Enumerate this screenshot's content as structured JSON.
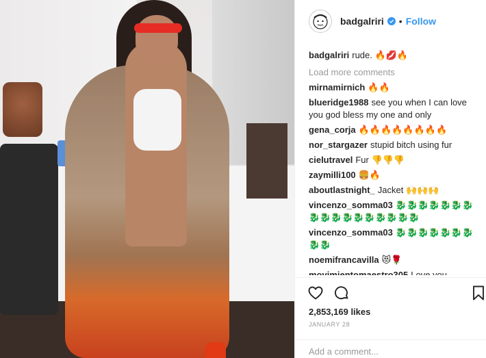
{
  "post": {
    "username": "badgalriri",
    "dot": "•",
    "follow_label": "Follow",
    "caption_user": "badgalriri",
    "caption_text": "rude. 🔥💋🔥",
    "load_more": "Load more comments",
    "likes": "2,853,169 likes",
    "date": "JANUARY 28",
    "add_comment_placeholder": "Add a comment..."
  },
  "comments": [
    {
      "user": "mirnamirnich",
      "text": "🔥🔥"
    },
    {
      "user": "blueridge1988",
      "text": "see you when I can love you god bless my one and only"
    },
    {
      "user": "gena_corja",
      "text": "🔥🔥🔥🔥🔥🔥🔥🔥"
    },
    {
      "user": "nor_stargazer",
      "text": "stupid bitch using fur"
    },
    {
      "user": "cielutravel",
      "text": "Fur 👎👎👎"
    },
    {
      "user": "zaymilli100",
      "text": "🍔🔥"
    },
    {
      "user": "aboutlastnight_",
      "text": "Jacket 🙌🙌🙌"
    },
    {
      "user": "vincenzo_somma03",
      "text": "🐉🐉🐉🐉🐉🐉🐉🐉🐉🐉🐉🐉🐉🐉🐉🐉🐉"
    },
    {
      "user": "vincenzo_somma03",
      "text": "🐉🐉🐉🐉🐉🐉🐉🐉🐉"
    },
    {
      "user": "noemifrancavilla",
      "text": "😻🌹"
    },
    {
      "user": "movimientomaestro305",
      "text": "Love you"
    }
  ],
  "icons": {
    "like": "heart-icon",
    "comment": "comment-icon",
    "save": "bookmark-icon",
    "verified": "verified-badge-icon"
  },
  "colors": {
    "link": "#3897f0",
    "muted": "#999999",
    "text": "#262626"
  }
}
